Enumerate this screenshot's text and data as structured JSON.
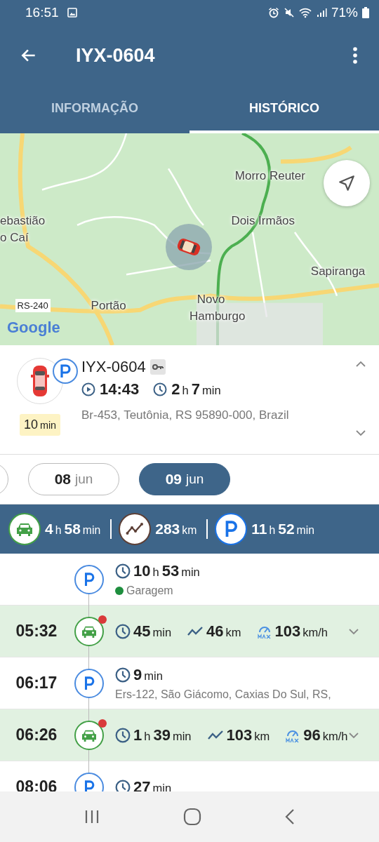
{
  "status_bar": {
    "time": "16:51",
    "battery": "71%"
  },
  "app_bar": {
    "title": "IYX-0604"
  },
  "tabs": [
    {
      "label": "INFORMAÇÃO",
      "selected": false
    },
    {
      "label": "HISTÓRICO",
      "selected": true
    }
  ],
  "map": {
    "labels": [
      {
        "text": "Morro Reuter",
        "kind": "place"
      },
      {
        "text": "ebastião",
        "kind": "place"
      },
      {
        "text": "Dois Irmãos",
        "kind": "place"
      },
      {
        "text": "o Caí",
        "kind": "place"
      },
      {
        "text": "Sapiranga",
        "kind": "place"
      },
      {
        "text": "Novo",
        "kind": "place"
      },
      {
        "text": "RS-240",
        "kind": "road"
      },
      {
        "text": "Portão",
        "kind": "place"
      },
      {
        "text": "Hamburgo",
        "kind": "place"
      }
    ],
    "logo": "Google"
  },
  "vehicle": {
    "plate": "IYX-0604",
    "start": "14:43",
    "duration": [
      {
        "n": "2",
        "u": "h"
      },
      {
        "n": "7",
        "u": "min"
      }
    ],
    "address": "Br-453, Teutônia, RS 95890-000, Brazil",
    "badge": [
      {
        "n": "10",
        "u": "min"
      }
    ]
  },
  "dates": [
    {
      "day": "08",
      "month": "jun",
      "selected": false
    },
    {
      "day": "09",
      "month": "jun",
      "selected": true
    }
  ],
  "summary": [
    {
      "kind": "drive",
      "value": [
        {
          "n": "4",
          "u": "h"
        },
        {
          "n": "58",
          "u": "min"
        }
      ]
    },
    {
      "kind": "distance",
      "value": [
        {
          "n": "283",
          "u": "km"
        }
      ]
    },
    {
      "kind": "parking",
      "value": [
        {
          "n": "11",
          "u": "h"
        },
        {
          "n": "52",
          "u": "min"
        }
      ]
    }
  ],
  "timeline": [
    {
      "kind": "parking",
      "duration": [
        {
          "n": "10",
          "u": "h"
        },
        {
          "n": "53",
          "u": "min"
        }
      ],
      "place": {
        "name": "Garagem",
        "color": "#1e8e3e"
      }
    },
    {
      "kind": "drive",
      "time": "05:32",
      "alert": true,
      "duration": [
        {
          "n": "45",
          "u": "min"
        }
      ],
      "distance": [
        {
          "n": "46",
          "u": "km"
        }
      ],
      "speed": [
        {
          "n": "103",
          "u": "km/h"
        }
      ]
    },
    {
      "kind": "parking",
      "time": "06:17",
      "duration": [
        {
          "n": "9",
          "u": "min"
        }
      ],
      "address": "Ers-122, São Giácomo, Caxias Do Sul, RS,"
    },
    {
      "kind": "drive",
      "time": "06:26",
      "alert": true,
      "duration": [
        {
          "n": "1",
          "u": "h"
        },
        {
          "n": "39",
          "u": "min"
        }
      ],
      "distance": [
        {
          "n": "103",
          "u": "km"
        }
      ],
      "speed": [
        {
          "n": "96",
          "u": "km/h"
        }
      ]
    },
    {
      "kind": "parking",
      "time": "08:06",
      "duration": [
        {
          "n": "27",
          "u": "min"
        }
      ]
    }
  ]
}
